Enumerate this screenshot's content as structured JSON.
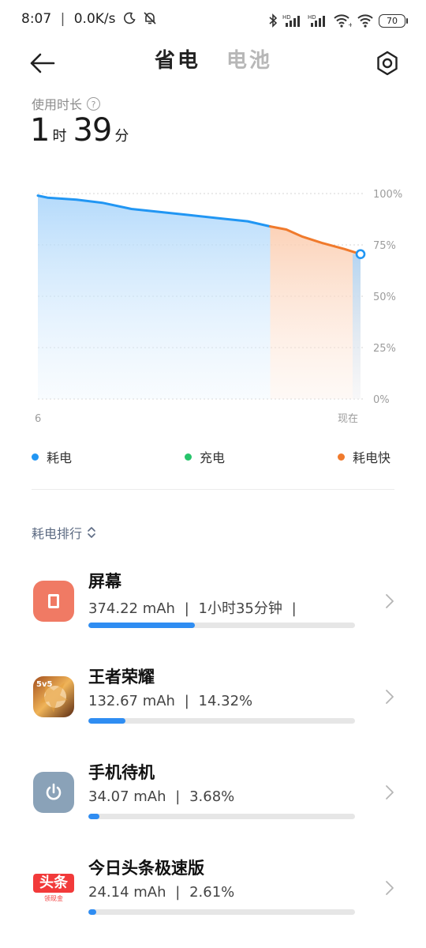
{
  "status_bar": {
    "time": "8:07",
    "net_speed": "0.0K/s",
    "battery": "70"
  },
  "header": {
    "tabs": [
      {
        "label": "省电",
        "active": true
      },
      {
        "label": "电池",
        "active": false
      }
    ]
  },
  "usage": {
    "label": "使用时长",
    "hours": "1",
    "hours_unit": "时",
    "minutes": "39",
    "minutes_unit": "分"
  },
  "chart_data": {
    "type": "line",
    "y_ticks": [
      "100%",
      "75%",
      "50%",
      "25%",
      "0%"
    ],
    "ylim": [
      0,
      100
    ],
    "x_tick_labels": [
      "6",
      "现在"
    ],
    "grid": true,
    "series": [
      {
        "name": "耗电",
        "color": "#2196f3",
        "x": [
          0,
          0.03,
          0.12,
          0.2,
          0.29,
          0.38,
          0.47,
          0.56,
          0.65,
          0.72
        ],
        "values": [
          99,
          98,
          97,
          95.5,
          92.5,
          91,
          89.5,
          88,
          86.5,
          84
        ]
      },
      {
        "name": "耗电快",
        "color": "#f07a2c",
        "x": [
          0.72,
          0.77,
          0.82,
          0.88,
          0.95,
          1.0
        ],
        "values": [
          84,
          82.5,
          79,
          76,
          73,
          70.5
        ]
      }
    ],
    "current_value": 70.5
  },
  "legend": {
    "items": [
      {
        "label": "耗电",
        "color": "#2196f3"
      },
      {
        "label": "充电",
        "color": "#27c46b"
      },
      {
        "label": "耗电快",
        "color": "#f07a2c"
      }
    ]
  },
  "ranking": {
    "title": "耗电排行",
    "items": [
      {
        "name": "屏幕",
        "mah": "374.22 mAh",
        "sep": "|",
        "extra": "1小时35分钟",
        "tail": "|",
        "fraction": 0.4,
        "icon": "screen-icon",
        "color": "#f07a64"
      },
      {
        "name": "王者荣耀",
        "mah": "132.67 mAh",
        "sep": "|",
        "extra": "14.32%",
        "tail": "",
        "fraction": 0.14,
        "icon": "honor-of-kings-icon",
        "color": "#7a3e1f"
      },
      {
        "name": "手机待机",
        "mah": "34.07 mAh",
        "sep": "|",
        "extra": "3.68%",
        "tail": "",
        "fraction": 0.04,
        "icon": "power-icon",
        "color": "#8aa2b8"
      },
      {
        "name": "今日头条极速版",
        "mah": "24.14 mAh",
        "sep": "|",
        "extra": "2.61%",
        "tail": "",
        "fraction": 0.03,
        "icon": "toutiao-icon",
        "color": "#f23a3a",
        "icon_text": "头条",
        "icon_sub": "领现金"
      }
    ]
  }
}
